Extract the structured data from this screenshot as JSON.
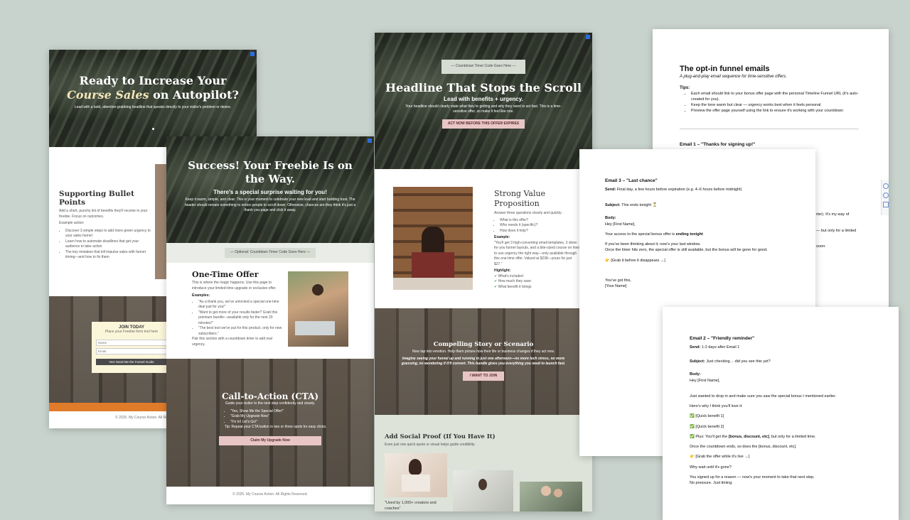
{
  "page1": {
    "hero_title_a": "Ready to Increase Your ",
    "hero_title_em": "Course Sales",
    "hero_title_b": " on Autopilot?",
    "hero_sub": "Lead with a bold, attention-grabbing headline that speaks directly to your visitor's problem or desire.",
    "bullets_title": "Supporting Bullet Points",
    "bullets_intro": "Add a short, punchy list of benefits they'll receive in your freebie. Focus on outcomes.",
    "example_label": "Example action:",
    "bullets": [
      "Discover 3 simple steps to add more green urgency to your sales funnel",
      "Learn how to automate deadlines that get your audience to take action",
      "The key mistakes that kill impulse sales with funnel timing—and how to fix them"
    ],
    "optin_title": "JOIN TODAY",
    "optin_sub": "Place your Freebie form tool here",
    "name_placeholder": "Name",
    "email_placeholder": "Email",
    "optin_button": "Yes! Send Me the Funnel Guide",
    "footer": "© 2025. My Course Action. All Rights Reserved."
  },
  "page2": {
    "hero_title": "Success! Your Freebie Is on the Way.",
    "hero_sub": "There's a special surprise waiting for you!",
    "hero_body": "Keep it warm, simple, and clear. This is your moment to celebrate your new lead and start building trust. The header should remain something to entice people to scroll down. Otherwise, chances are they think it's just a thank you page and click it away.",
    "countdown": "— Optional: Countdown Timer Code Goes Here —",
    "offer_title": "One-Time Offer",
    "offer_intro": "This is where the magic happens. Use this page to introduce your limited-time upgrade or exclusive offer.",
    "examples_label": "Examples:",
    "examples": [
      "\"As a thank you, we've unlocked a special one-time deal just for you!\"",
      "\"Want to get more of your results faster? Grab this premium bundle—available only for the next 20 minutes!\"",
      "\"The best tool we've put for this product, only for new subscribers.\""
    ],
    "offer_note": "Pair this section with a countdown timer to add real urgency.",
    "cta_title": "Call-to-Action (CTA)",
    "cta_intro": "Guide your visitor to the next step confidently and clearly.",
    "cta_examples": [
      "\"Yes, Show Me the Special Offer!\"",
      "\"Grab My Upgrade Now\"",
      "\"I'm In! Let's Go!\""
    ],
    "cta_note": "Tip: Repeat your CTA button in two or three spots for easy clicks.",
    "cta_button": "Claim My Upgrade Now",
    "footer": "© 2025. My Course Action. All Rights Reserved."
  },
  "page3": {
    "countdown": "— Countdown Timer Code Goes Here —",
    "hero_title": "Headline That Stops the Scroll",
    "hero_sub": "Lead with benefits + urgency.",
    "hero_body": "Your headline should clearly state what they're getting and why they need to act fast. This is a time-sensitive offer, so make it feel like one.",
    "hero_button": "ACT NOW BEFORE THIS OFFER EXPIRES",
    "value_title": "Strong Value Proposition",
    "value_intro": "Answer three questions clearly and quickly:",
    "value_q": [
      "What is this offer?",
      "Who needs it (specific)?",
      "How does it help?"
    ],
    "example_label": "Example:",
    "example_text": "\"You'll get 3 high-converting email templates, 3 done-for-you funnel layouts, and a bite-sized course on how to use urgency the right way—only available through this one-time offer. Valued at $238—yours for just $27.\"",
    "highlight_label": "Highlight:",
    "highlights": [
      "What's included",
      "How much they save",
      "What benefit it brings"
    ],
    "story_title": "Compelling Story or Scenario",
    "story_body": "Now tap into emotion. Help them picture how their life or business changes if they act now.",
    "story_quote": "Imagine seeing your funnel up and running in just one afternoon—no more tech stress, no more guessing, no wondering if it'll convert. This bundle gives you everything you need to launch fast.",
    "story_button": "I WANT TO JOIN",
    "social_title": "Add Social Proof (If You Have It)",
    "social_intro": "Even just one quick quote or visual helps guide credibility.",
    "social_quote": "\"Used by 1,000+ creators and coaches\""
  },
  "doc1": {
    "title": "The opt-in funnel emails",
    "subtitle": "A plug-and-play email sequence for time-sensitive offers.",
    "tips_label": "Tips:",
    "tips": [
      "Each email should link to your bonus offer page with the personal Timeline Funnel URL (it's auto-created for you).",
      "Keep the tone warm but clear — urgency works best when it feels personal",
      "Preview the offer page yourself using the link to ensure it's working with your countdown"
    ],
    "email1_label": "Email 1 – \"Thanks for signing up!\"",
    "fragment1": "rter). It's my way of",
    "fragment2": "— but only for a limited",
    "fragment3": "soon:"
  },
  "doc2": {
    "heading": "Email 3 – \"Last chance\"",
    "send_label": "Send:",
    "send_text": " Final day, a few hours before expiration (e.g. 4–6 hours before midnight)",
    "subject_label": "Subject:",
    "subject_text": " This ends tonight ⏳",
    "body_label": "Body:",
    "greeting": "Hey [First Name],",
    "access_a": "Your access to the special bonus offer is ",
    "access_b": "ending tonight",
    "line1": "If you've been thinking about it, now's your last window.",
    "line2": "Once the timer hits zero, the special offer is still available, but the bonus will be gone for good.",
    "cta": "👉 [Grab it before it disappears →]",
    "signoff1": "You've got this,",
    "signoff2": "[Your Name]"
  },
  "doc3": {
    "heading": "Email 2 – \"Friendly reminder\"",
    "send_label": "Send:",
    "send_text": " 1-2 days after Email 1",
    "subject_label": "Subject:",
    "subject_text": " Just checking… did you see this yet?",
    "body_label": "Body:",
    "greeting": "Hey [First Name],",
    "line1": "Just wanted to drop in and make sure you saw the special bonus I mentioned earlier.",
    "line2": "Here's why I think you'll love it:",
    "benefit1": "✅ [Quick benefit 1]",
    "benefit2": "✅ [Quick benefit 2]",
    "plus_a": "✅ Plus: You'll get the ",
    "plus_b": "[bonus, discount, etc]",
    "plus_c": ", but only for a limited time.",
    "line3": "Once the countdown ends, so does the [bonus, discount, etc].",
    "cta": "👉 [Grab the offer while it's live →]",
    "line4": "Why wait until it's gone?",
    "line5": "You signed up for a reason — now's your moment to take that next step.",
    "line6": "No pressure. Just timing."
  },
  "colors": {
    "background": "#c9d3cd",
    "pink_button": "#e8c6c6",
    "orange_bar": "#e07b2a",
    "sage": "#dde3d8",
    "check_green": "#2ea043"
  }
}
